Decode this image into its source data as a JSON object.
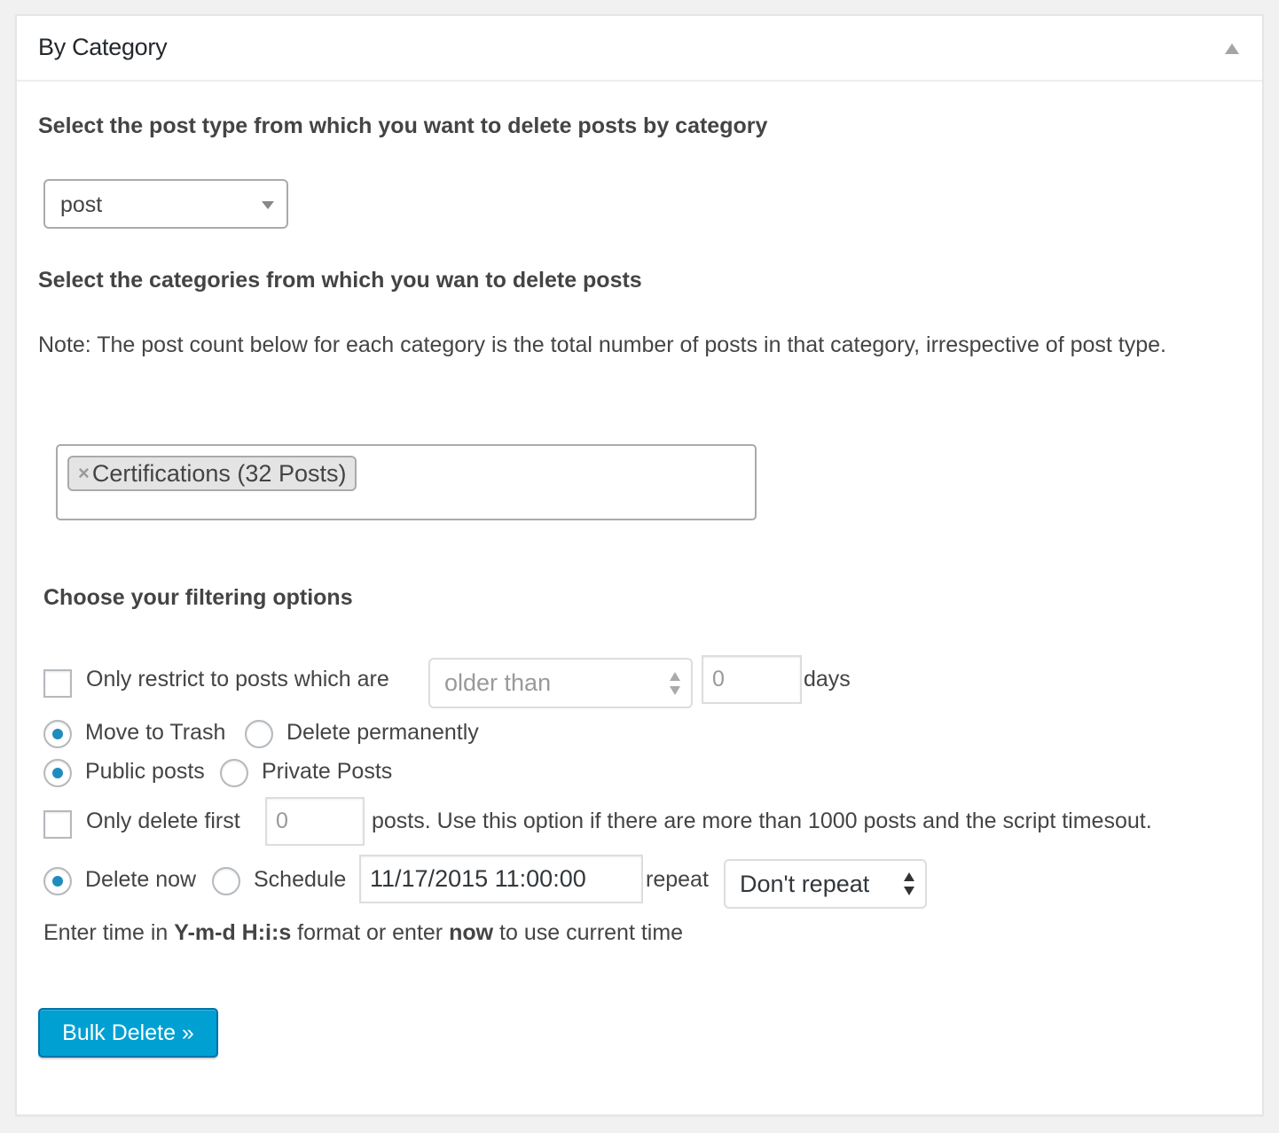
{
  "panel": {
    "title": "By Category",
    "toggle_icon": "triangle-up-icon"
  },
  "post_type": {
    "heading": "Select the post type from which you want to delete posts by category",
    "selected": "post"
  },
  "categories": {
    "heading": "Select the categories from which you wan to delete posts",
    "note": "Note: The post count below for each category is the total number of posts in that category, irrespective of post type.",
    "selected_tokens": [
      {
        "label": "Certifications (32 Posts)",
        "remove_symbol": "×"
      }
    ]
  },
  "filtering": {
    "heading": "Choose your filtering options",
    "restrict": {
      "checked": false,
      "label": "Only restrict to posts which are",
      "comparator_selected": "older than",
      "days_value": "0",
      "days_label": "days"
    },
    "delete_mode": {
      "options": [
        {
          "label": "Move to Trash",
          "checked": true
        },
        {
          "label": "Delete permanently",
          "checked": false
        }
      ]
    },
    "visibility": {
      "options": [
        {
          "label": "Public posts",
          "checked": true
        },
        {
          "label": "Private Posts",
          "checked": false
        }
      ]
    },
    "limit": {
      "checked": false,
      "label": "Only delete first",
      "value": "0",
      "suffix": "posts. Use this option if there are more than 1000 posts and the script timesout."
    },
    "schedule": {
      "options": [
        {
          "label": "Delete now",
          "checked": true
        },
        {
          "label": "Schedule",
          "checked": false
        }
      ],
      "datetime_value": "11/17/2015 11:00:00",
      "repeat_label": "repeat",
      "repeat_selected": "Don't repeat"
    },
    "time_hint": {
      "part1": "Enter time in ",
      "format": "Y-m-d H:i:s",
      "part2": " format or enter ",
      "now": "now",
      "part3": " to use current time"
    }
  },
  "actions": {
    "submit_label": "Bulk Delete »"
  },
  "colors": {
    "primary_button": "#00a0d2",
    "radio_dot": "#1e8cbe",
    "page_bg": "#f1f1f1"
  }
}
